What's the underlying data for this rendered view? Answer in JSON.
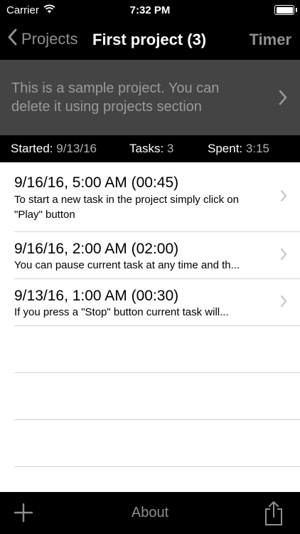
{
  "status_bar": {
    "carrier": "Carrier",
    "time": "7:32 PM"
  },
  "nav": {
    "back_label": "Projects",
    "title": "First project (3)",
    "timer_label": "Timer"
  },
  "project": {
    "description": "This is a sample project. You can delete it using projects section"
  },
  "stats": {
    "started_label": "Started:",
    "started_value": "9/13/16",
    "tasks_label": "Tasks:",
    "tasks_value": "3",
    "spent_label": "Spent:",
    "spent_value": "3:15"
  },
  "tasks": [
    {
      "title": "9/16/16, 5:00 AM (00:45)",
      "desc": "To start a new task in the project simply click on \"Play\" button"
    },
    {
      "title": "9/16/16, 2:00 AM (02:00)",
      "desc": "You can pause current task at any time and th..."
    },
    {
      "title": "9/13/16, 1:00 AM (00:30)",
      "desc": "If you press a \"Stop\" button current task will..."
    }
  ],
  "toolbar": {
    "about_label": "About"
  },
  "icons": {
    "back": "chevron-left-icon",
    "chevron": "chevron-right-icon",
    "add": "plus-icon",
    "share": "share-icon",
    "wifi": "wifi-icon",
    "battery": "battery-icon"
  },
  "colors": {
    "bar_background": "#000000",
    "description_background": "#444444",
    "muted_text": "#8e8e93",
    "separator": "#d4d4d4"
  }
}
